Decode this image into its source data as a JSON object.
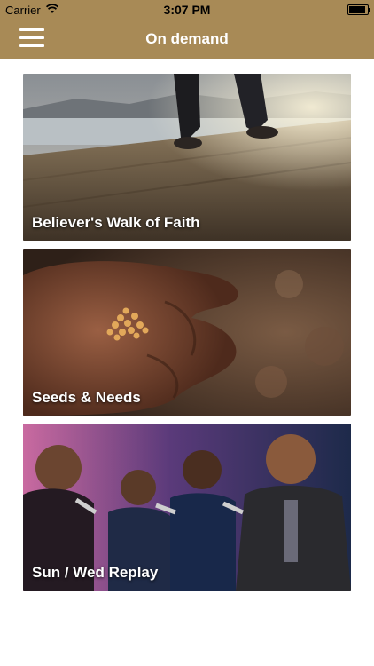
{
  "status": {
    "carrier": "Carrier",
    "time": "3:07 PM"
  },
  "nav": {
    "title": "On demand"
  },
  "cards": [
    {
      "title": "Believer's Walk of Faith"
    },
    {
      "title": "Seeds & Needs"
    },
    {
      "title": "Sun / Wed Replay"
    }
  ],
  "colors": {
    "bar": "#a88a56",
    "text_light": "#ffffff"
  },
  "icons": [
    "menu-icon",
    "wifi-icon",
    "battery-icon"
  ]
}
